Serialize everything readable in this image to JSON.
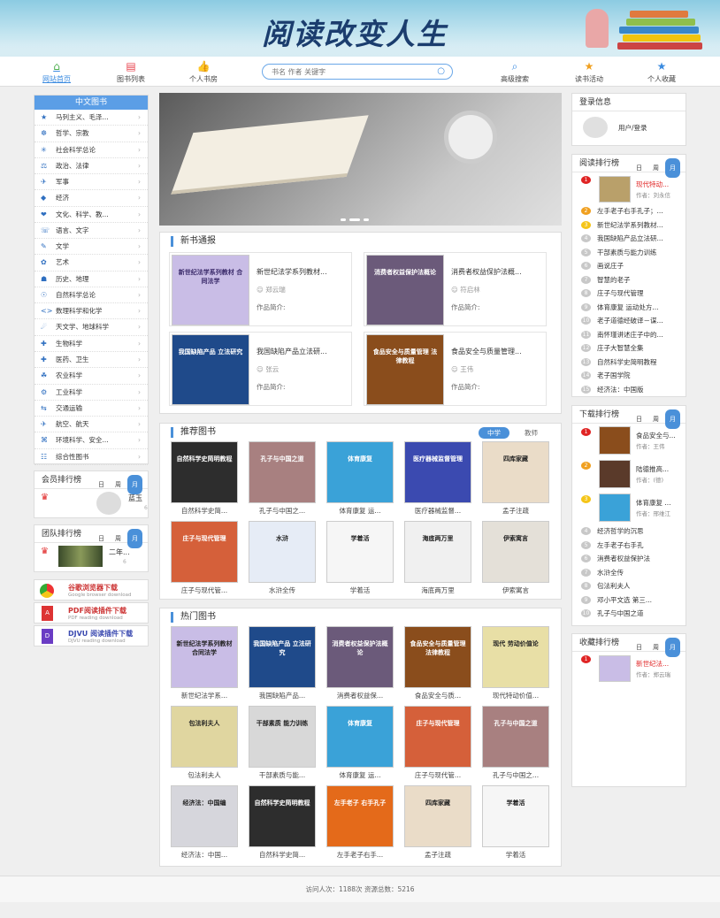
{
  "banner": {
    "title": "阅读改变人生"
  },
  "nav": {
    "items": [
      {
        "label": "网站首页",
        "icon": "home-icon"
      },
      {
        "label": "图书列表",
        "icon": "list-icon"
      },
      {
        "label": "个人书房",
        "icon": "thumbs-up-icon"
      },
      {
        "label": "高级搜索",
        "icon": "advanced-search-icon"
      },
      {
        "label": "读书活动",
        "icon": "star-icon"
      },
      {
        "label": "个人收藏",
        "icon": "star-icon"
      }
    ],
    "search_placeholder": "书名 作者 关键字"
  },
  "categories": {
    "title": "中文图书",
    "items": [
      "马列主义、毛泽...",
      "哲学、宗教",
      "社会科学总论",
      "政治、法律",
      "军事",
      "经济",
      "文化、科学、教...",
      "语言、文字",
      "文学",
      "艺术",
      "历史、地理",
      "自然科学总论",
      "数理科学和化学",
      "天文学、地球科学",
      "生物科学",
      "医药、卫生",
      "农业科学",
      "工业科学",
      "交通运输",
      "航空、航天",
      "环境科学、安全...",
      "综合性图书"
    ]
  },
  "member_rank": {
    "title": "会员排行榜",
    "tabs": [
      "日",
      "周",
      "月"
    ],
    "name": "蓝玉",
    "count": "6"
  },
  "team_rank": {
    "title": "团队排行榜",
    "tabs": [
      "日",
      "周",
      "月"
    ],
    "name": "二年...",
    "count": "6"
  },
  "downloads": [
    {
      "title": "谷歌浏览器下载",
      "sub": "Google browser download",
      "icon": "chrome-icon"
    },
    {
      "title": "PDF阅读插件下载",
      "sub": "PDF reading download",
      "icon": "pdf-icon"
    },
    {
      "title": "DJVU 阅读插件下载",
      "sub": "DJVU reading download",
      "icon": "djvu-icon"
    }
  ],
  "new_books": {
    "title": "新书通报",
    "items": [
      {
        "title": "新世纪法学系列教材...",
        "author": "郑云瑞",
        "desc": "作品简介:",
        "cover_text": "新世纪法学系列教材 合同法学",
        "cover_color": "#c9bde6"
      },
      {
        "title": "消费者权益保护法概...",
        "author": "符启林",
        "desc": "作品简介:",
        "cover_text": "消费者权益保护法概论",
        "cover_color": "#6b5a7a"
      },
      {
        "title": "我国缺陷产品立法研...",
        "author": "张云",
        "desc": "作品简介:",
        "cover_text": "我国缺陷产品 立法研究",
        "cover_color": "#1f4a8a"
      },
      {
        "title": "食品安全与质量管理...",
        "author": "王伟",
        "desc": "作品简介:",
        "cover_text": "食品安全与质量管理 法律教程",
        "cover_color": "#8a4d1c"
      }
    ]
  },
  "recommend": {
    "title": "推荐图书",
    "tabs": [
      "中学",
      "教师"
    ],
    "items": [
      {
        "title": "自然科学史简...",
        "cover_text": "自然科学史简明教程",
        "cover_color": "#2d2d2d"
      },
      {
        "title": "孔子与中国之...",
        "cover_text": "孔子与中国之道",
        "cover_color": "#a88080"
      },
      {
        "title": "体育康复 运...",
        "cover_text": "体育康复",
        "cover_color": "#3aa2d8"
      },
      {
        "title": "医疗器械监督...",
        "cover_text": "医疗器械监督管理",
        "cover_color": "#3b4ab0"
      },
      {
        "title": "孟子注疏",
        "cover_text": "四库家藏",
        "cover_color": "#eadcc8"
      },
      {
        "title": "庄子与现代管...",
        "cover_text": "庄子与现代管理",
        "cover_color": "#d5603a"
      },
      {
        "title": "水浒全传",
        "cover_text": "水浒",
        "cover_color": "#e6ecf6"
      },
      {
        "title": "学着活",
        "cover_text": "学着活",
        "cover_color": "#f6f6f6"
      },
      {
        "title": "海底两万里",
        "cover_text": "海底两万里",
        "cover_color": "#f0f0f0"
      },
      {
        "title": "伊索寓言",
        "cover_text": "伊索寓言",
        "cover_color": "#e4e0d8"
      }
    ]
  },
  "hot": {
    "title": "热门图书",
    "items": [
      {
        "title": "新世纪法学系...",
        "cover_text": "新世纪法学系列教材 合同法学",
        "cover_color": "#c9bde6"
      },
      {
        "title": "我国缺陷产品...",
        "cover_text": "我国缺陷产品 立法研究",
        "cover_color": "#1f4a8a"
      },
      {
        "title": "消费者权益保...",
        "cover_text": "消费者权益保护法概论",
        "cover_color": "#6b5a7a"
      },
      {
        "title": "食品安全与质...",
        "cover_text": "食品安全与质量管理 法律教程",
        "cover_color": "#8a4d1c"
      },
      {
        "title": "现代特动价值...",
        "cover_text": "现代 劳动价值论",
        "cover_color": "#e8dfa6"
      },
      {
        "title": "包法利夫人",
        "cover_text": "包法利夫人",
        "cover_color": "#e0d6a0"
      },
      {
        "title": "干部素质与能...",
        "cover_text": "干部素质 能力训练",
        "cover_color": "#d8d8d8"
      },
      {
        "title": "体育康复 运...",
        "cover_text": "体育康复",
        "cover_color": "#3aa2d8"
      },
      {
        "title": "庄子与现代管...",
        "cover_text": "庄子与现代管理",
        "cover_color": "#d5603a"
      },
      {
        "title": "孔子与中国之...",
        "cover_text": "孔子与中国之道",
        "cover_color": "#a88080"
      },
      {
        "title": "经济法：中国...",
        "cover_text": "经济法：中国编",
        "cover_color": "#d6d6dc"
      },
      {
        "title": "自然科学史简...",
        "cover_text": "自然科学史简明教程",
        "cover_color": "#2d2d2d"
      },
      {
        "title": "左手老子右手...",
        "cover_text": "左手老子 右手孔子",
        "cover_color": "#e46a1a"
      },
      {
        "title": "孟子注疏",
        "cover_text": "四库家藏",
        "cover_color": "#eadcc8"
      },
      {
        "title": "学着活",
        "cover_text": "学着活",
        "cover_color": "#f6f6f6"
      }
    ]
  },
  "login": {
    "title": "登录信息",
    "link": "用户/登录"
  },
  "read_rank": {
    "title": "阅读排行榜",
    "tabs": [
      "日",
      "周",
      "月"
    ],
    "top": {
      "title": "现代特动...",
      "author": "作者：刘永信"
    },
    "items": [
      "左手老子右手孔子；...",
      "新世纪法学系列教材...",
      "我国缺陷产品立法研...",
      "干部素质与能力训练",
      "画说庄子",
      "智慧的老子",
      "庄子与现代管理",
      "体育康复 运动处方...",
      "老子道德经破译－谋...",
      "南怀瑾讲述庄子中的...",
      "庄子大智慧全集",
      "自然科学史简明教程",
      "老子国学院",
      "经济法：中国版"
    ]
  },
  "download_rank": {
    "title": "下载排行榜",
    "tabs": [
      "日",
      "周",
      "月"
    ],
    "top": [
      {
        "title": "食品安全与...",
        "author": "作者：王伟"
      },
      {
        "title": "陆德推高...",
        "author": "作者：(德)"
      },
      {
        "title": "体育康复 ...",
        "author": "作者：邢维江"
      }
    ],
    "items": [
      "经济哲学的沉思",
      "左手老子右手孔",
      "消费者权益保护法",
      "水浒全传",
      "包法利夫人",
      "邓小平文选 第三...",
      "孔子与中国之道"
    ]
  },
  "collect_rank": {
    "title": "收藏排行榜",
    "tabs": [
      "日",
      "周",
      "月"
    ],
    "top": {
      "title": "新世纪法...",
      "author": "作者：郑云瑞"
    }
  },
  "footer": {
    "text": "访问人次：1188次   资源总数：5216"
  }
}
